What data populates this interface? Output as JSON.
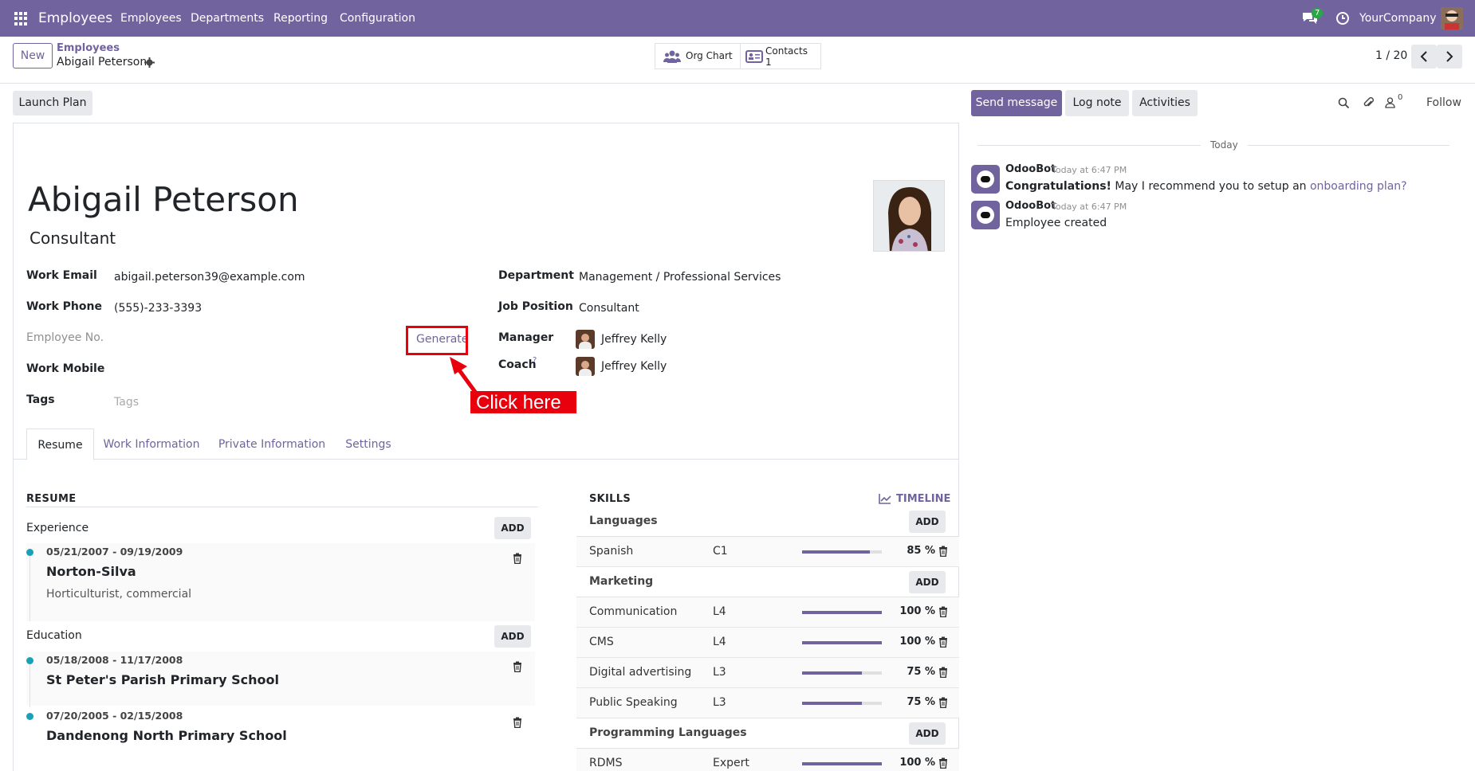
{
  "navbar": {
    "app_title": "Employees",
    "menu": [
      "Employees",
      "Departments",
      "Reporting",
      "Configuration"
    ],
    "messages_count": "7",
    "company": "YourCompany"
  },
  "control": {
    "new_label": "New",
    "breadcrumb_parent": "Employees",
    "breadcrumb_current": "Abigail Peterson",
    "org_chart_label": "Org Chart",
    "contacts_label": "Contacts",
    "contacts_count": "1",
    "pager": "1 / 20"
  },
  "action_bar": {
    "launch_plan": "Launch Plan",
    "send_message": "Send message",
    "log_note": "Log note",
    "activities": "Activities",
    "followers_count": "0",
    "follow": "Follow"
  },
  "employee": {
    "name": "Abigail Peterson",
    "job_title": "Consultant",
    "fields_left": [
      {
        "label": "Work Email",
        "value": "abigail.peterson39@example.com"
      },
      {
        "label": "Work Phone",
        "value": "(555)-233-3393"
      },
      {
        "label": "Employee No.",
        "value": ""
      },
      {
        "label": "Work Mobile",
        "value": ""
      },
      {
        "label": "Tags",
        "value": ""
      }
    ],
    "tags_placeholder": "Tags",
    "generate_label": "Generate",
    "fields_right": [
      {
        "label": "Department",
        "value": "Management / Professional Services"
      },
      {
        "label": "Job Position",
        "value": "Consultant"
      },
      {
        "label": "Manager",
        "value": "Jeffrey Kelly"
      },
      {
        "label": "Coach",
        "value": "Jeffrey Kelly"
      }
    ],
    "coach_help": "?"
  },
  "annotation": {
    "text": "Click here",
    "color": "#e8000d"
  },
  "tabs": [
    "Resume",
    "Work Information",
    "Private Information",
    "Settings"
  ],
  "resume": {
    "title": "RESUME",
    "add_label": "ADD",
    "experience": {
      "title": "Experience",
      "items": [
        {
          "dates": "05/21/2007 - 09/19/2009",
          "name": "Norton-Silva",
          "description": "Horticulturist, commercial"
        }
      ]
    },
    "education": {
      "title": "Education",
      "items": [
        {
          "dates": "05/18/2008 - 11/17/2008",
          "name": "St Peter's Parish Primary School"
        },
        {
          "dates": "07/20/2005 - 02/15/2008",
          "name": "Dandenong North Primary School"
        }
      ]
    }
  },
  "skills": {
    "title": "SKILLS",
    "timeline": "TIMELINE",
    "add_label": "ADD",
    "groups": [
      {
        "name": "Languages",
        "items": [
          {
            "name": "Spanish",
            "level": "C1",
            "progress": 85,
            "pct": "85 %"
          }
        ]
      },
      {
        "name": "Marketing",
        "items": [
          {
            "name": "Communication",
            "level": "L4",
            "progress": 100,
            "pct": "100 %"
          },
          {
            "name": "CMS",
            "level": "L4",
            "progress": 100,
            "pct": "100 %"
          },
          {
            "name": "Digital advertising",
            "level": "L3",
            "progress": 75,
            "pct": "75 %"
          },
          {
            "name": "Public Speaking",
            "level": "L3",
            "progress": 75,
            "pct": "75 %"
          }
        ]
      },
      {
        "name": "Programming Languages",
        "items": [
          {
            "name": "RDMS",
            "level": "Expert",
            "progress": 100,
            "pct": "100 %"
          }
        ]
      }
    ]
  },
  "chatter": {
    "today": "Today",
    "messages": [
      {
        "author": "OdooBot",
        "time": "Today at 6:47 PM",
        "bold": "Congratulations!",
        "text": " May I recommend you to setup an ",
        "link": "onboarding plan?"
      },
      {
        "author": "OdooBot",
        "time": "Today at 6:47 PM",
        "text": "Employee created"
      }
    ]
  },
  "colors": {
    "brand": "#71639e",
    "navbar": "#71639e",
    "timeline_dot": "#17a2b8",
    "progress": "#71639e"
  }
}
